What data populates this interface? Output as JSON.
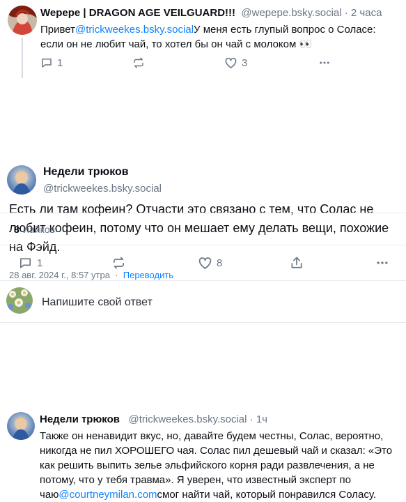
{
  "parent_post": {
    "author_name": "Wepepe | DRAGON AGE VEILGUARD!!!",
    "author_handle": "@wepepe.bsky.social",
    "time": "2 часа",
    "text_before": "Привет",
    "mention": "@trickweekes.bsky.social",
    "text_after": "У меня есть глупый вопрос о Соласе: если он не любит чай, то хотел бы он чай с молоком 👀",
    "reply_count": "1",
    "repost_count": "",
    "like_count": "3"
  },
  "main_post": {
    "author_name": "Недели трюков",
    "author_handle": "@trickweekes.bsky.social",
    "text": "Есть ли там кофеин? Отчасти это связано с тем, что Солас не любит кофеин, потому что он мешает ему делать вещи, похожие на Фэйд.",
    "timestamp": "28 авг. 2024 г., 8:57 утра",
    "separator": "·",
    "translate_label": "Переводить",
    "likes_count": "8",
    "likes_label": "лайков",
    "reply_count": "1",
    "like_count": "8"
  },
  "reply_composer": {
    "placeholder": "Напишите свой ответ"
  },
  "reply_post": {
    "author_name": "Недели трюков",
    "author_handle": "@trickweekes.bsky.social",
    "time": "1ч",
    "text_before": "Также он ненавидит вкус, но, давайте будем честны, Солас, вероятно, никогда не пил ХОРОШЕГО чая. Солас пил дешевый чай и сказал: «Это как решить выпить зелье эльфийского корня ради развлечения, а не потому, что у тебя травма». Я уверен, что известный эксперт по чаю",
    "mention": "@courtneymilan.com",
    "text_after": "смог найти чай, который понравился Соласу."
  },
  "colors": {
    "link": "#1083fe",
    "muted": "#6b7785",
    "divider": "#e6eaee"
  },
  "icons": [
    "reply-icon",
    "repost-icon",
    "like-icon",
    "more-icon",
    "share-icon"
  ]
}
